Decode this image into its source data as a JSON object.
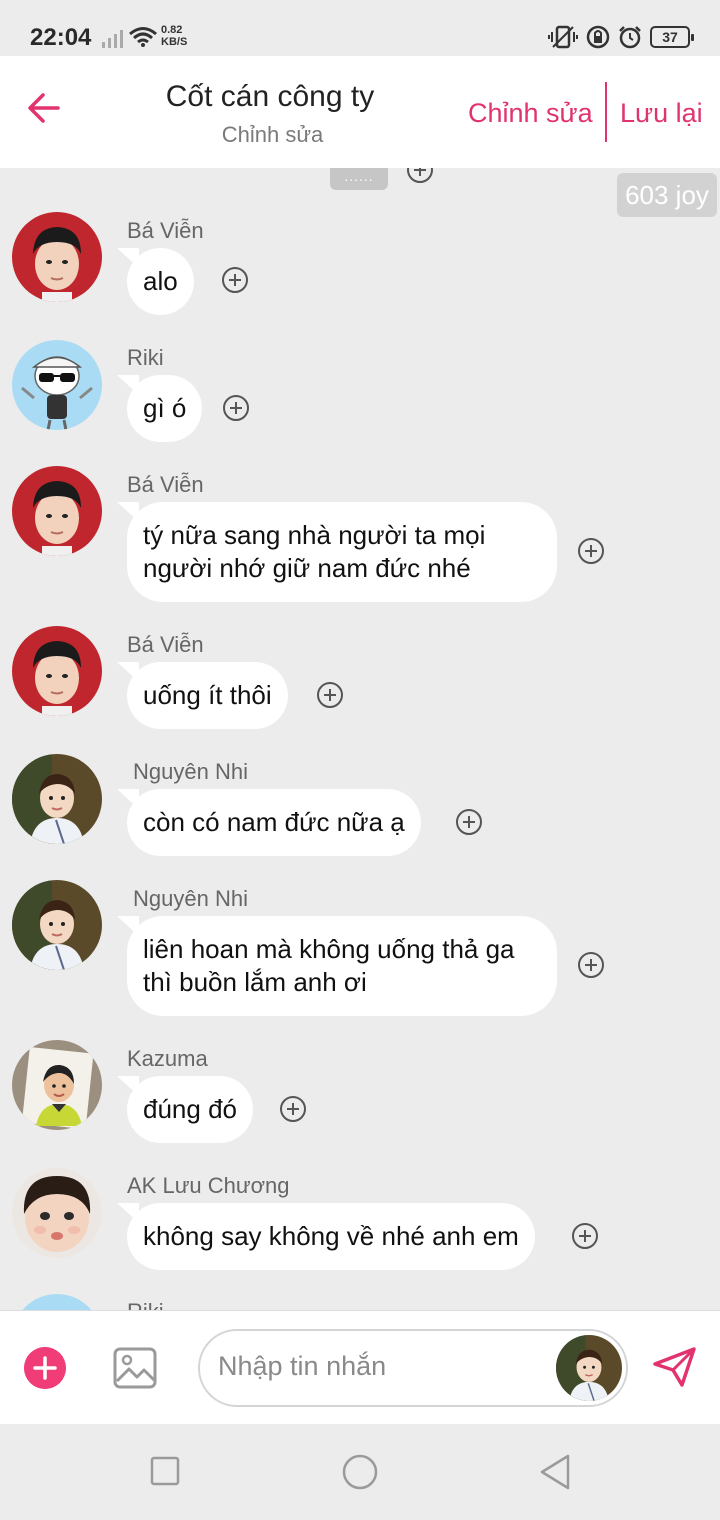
{
  "status": {
    "time": "22:04",
    "speed_value": "0.82",
    "speed_unit": "KB/S",
    "battery": "37"
  },
  "header": {
    "title": "Cốt cán công ty",
    "subtitle": "Chỉnh sửa",
    "edit_label": "Chỉnh sửa",
    "save_label": "Lưu lại"
  },
  "chat": {
    "more_indicator": "......",
    "joy_badge": "603 joy",
    "messages": [
      {
        "sender": "Bá Viễn",
        "text": "alo",
        "avatar": "red-boy"
      },
      {
        "sender": "Riki",
        "text": "gì ó",
        "avatar": "cartoon-sunglasses"
      },
      {
        "sender": "Bá Viễn",
        "text": "tý nữa sang nhà người ta mọi người nhớ giữ nam đức nhé",
        "avatar": "red-boy"
      },
      {
        "sender": "Bá Viễn",
        "text": "uống ít thôi",
        "avatar": "red-boy"
      },
      {
        "sender": "Nguyên Nhi",
        "text": "còn có nam đức nữa ạ",
        "avatar": "child-forest"
      },
      {
        "sender": "Nguyên Nhi",
        "text": "liên hoan mà không uống thả ga thì buồn lắm anh ơi",
        "avatar": "child-forest"
      },
      {
        "sender": "Kazuma",
        "text": "đúng đó",
        "avatar": "child-photo"
      },
      {
        "sender": "AK Lưu Chương",
        "text": "không say không về nhé anh em",
        "avatar": "baby-face"
      },
      {
        "sender": "Riki",
        "avatar": "cartoon-sunglasses"
      }
    ]
  },
  "input": {
    "placeholder": "Nhập tin nhắn"
  },
  "colors": {
    "accent": "#e0336f",
    "background": "#ececec",
    "bubble": "#ffffff"
  },
  "icons": [
    "back-arrow-icon",
    "plus-circle-icon",
    "add-icon",
    "image-icon",
    "send-icon",
    "nav-square-icon",
    "nav-home-icon",
    "nav-back-icon"
  ]
}
